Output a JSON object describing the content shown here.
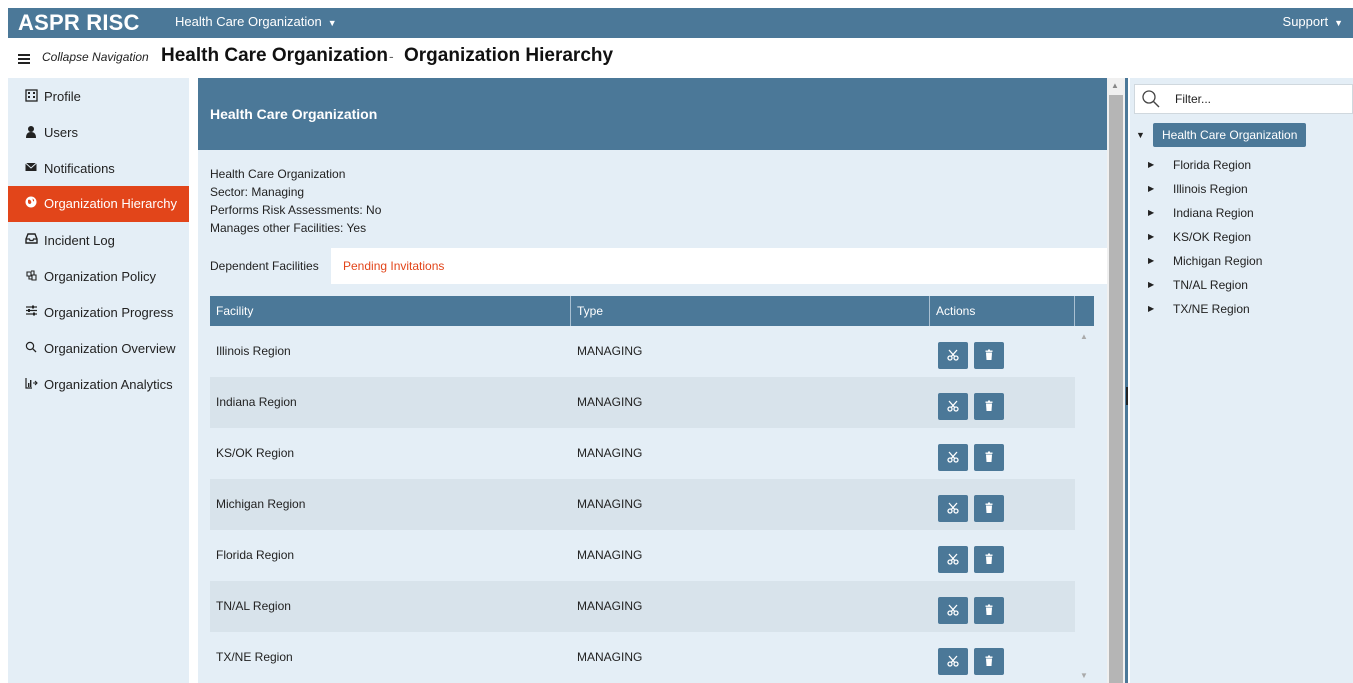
{
  "app": {
    "brand": "ASPR RISC",
    "org_menu": "Health Care Organization",
    "support_menu": "Support"
  },
  "titlebar": {
    "collapse_label": "Collapse Navigation",
    "title": "Health Care Organization",
    "separator": "-",
    "subtitle": "Organization Hierarchy"
  },
  "sidebar": {
    "items": [
      {
        "label": "Profile",
        "icon": "building-icon",
        "active": false
      },
      {
        "label": "Users",
        "icon": "user-icon",
        "active": false
      },
      {
        "label": "Notifications",
        "icon": "envelope-icon",
        "active": false
      },
      {
        "label": "Organization Hierarchy",
        "icon": "globe-icon",
        "active": true
      },
      {
        "label": "Incident Log",
        "icon": "inbox-icon",
        "active": false
      },
      {
        "label": "Organization Policy",
        "icon": "policy-icon",
        "active": false
      },
      {
        "label": "Organization Progress",
        "icon": "sliders-icon",
        "active": false
      },
      {
        "label": "Organization Overview",
        "icon": "search-icon",
        "active": false
      },
      {
        "label": "Organization Analytics",
        "icon": "analytics-icon",
        "active": false
      }
    ]
  },
  "org": {
    "header": "Health Care Organization",
    "name": "Health Care Organization",
    "sector": "Sector: Managing",
    "risk": "Performs Risk Assessments: No",
    "manages": "Manages other Facilities: Yes"
  },
  "tabs": {
    "dependent": "Dependent Facilities",
    "pending": "Pending Invitations"
  },
  "table": {
    "headers": [
      "Facility",
      "Type",
      "Actions"
    ],
    "rows": [
      {
        "facility": "Illinois Region",
        "type": "MANAGING"
      },
      {
        "facility": "Indiana Region",
        "type": "MANAGING"
      },
      {
        "facility": "KS/OK Region",
        "type": "MANAGING"
      },
      {
        "facility": "Michigan Region",
        "type": "MANAGING"
      },
      {
        "facility": "Florida Region",
        "type": "MANAGING"
      },
      {
        "facility": "TN/AL Region",
        "type": "MANAGING"
      },
      {
        "facility": "TX/NE Region",
        "type": "MANAGING"
      }
    ]
  },
  "tree": {
    "filter_placeholder": "Filter...",
    "root": "Health Care Organization",
    "children": [
      "Florida Region",
      "Illinois Region",
      "Indiana Region",
      "KS/OK Region",
      "Michigan Region",
      "TN/AL Region",
      "TX/NE Region"
    ]
  },
  "colors": {
    "primary": "#4b7898",
    "accent": "#e2451a",
    "panel": "#e4eef6"
  }
}
